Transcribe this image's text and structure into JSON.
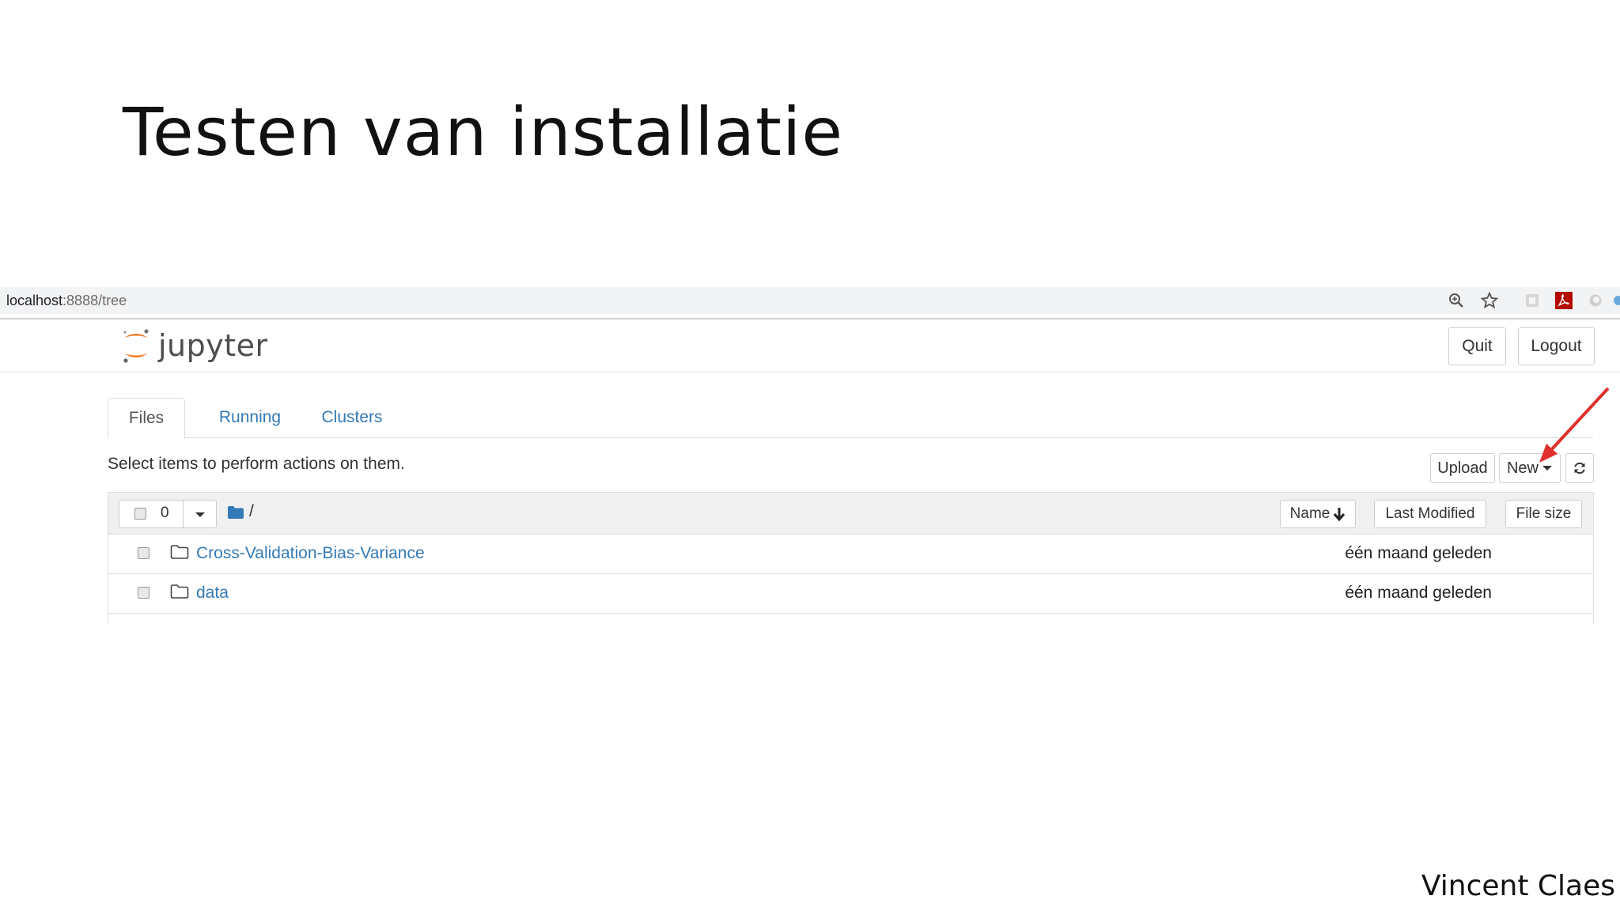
{
  "slide": {
    "title": "Testen van installatie",
    "author": "Vincent Claes"
  },
  "browser": {
    "url_host": "localhost",
    "url_rest": ":8888/tree",
    "icons": [
      "zoom-icon",
      "star-icon",
      "extension-icon",
      "pdf-icon",
      "circle-extension-icon"
    ]
  },
  "header": {
    "logo_text": "jupyter",
    "quit_label": "Quit",
    "logout_label": "Logout"
  },
  "tabs": [
    {
      "label": "Files",
      "active": true
    },
    {
      "label": "Running",
      "active": false
    },
    {
      "label": "Clusters",
      "active": false
    }
  ],
  "toolbar": {
    "hint": "Select items to perform actions on them.",
    "upload_label": "Upload",
    "new_label": "New"
  },
  "list": {
    "selected_count": "0",
    "path": "/",
    "columns": {
      "name": "Name",
      "last_modified": "Last Modified",
      "file_size": "File size"
    },
    "rows": [
      {
        "name": "Cross-Validation-Bias-Variance",
        "modified": "één maand geleden"
      },
      {
        "name": "data",
        "modified": "één maand geleden"
      }
    ]
  },
  "colors": {
    "link": "#337ab7",
    "jupyter_orange": "#f37726",
    "annotation_arrow": "#e0302b"
  }
}
